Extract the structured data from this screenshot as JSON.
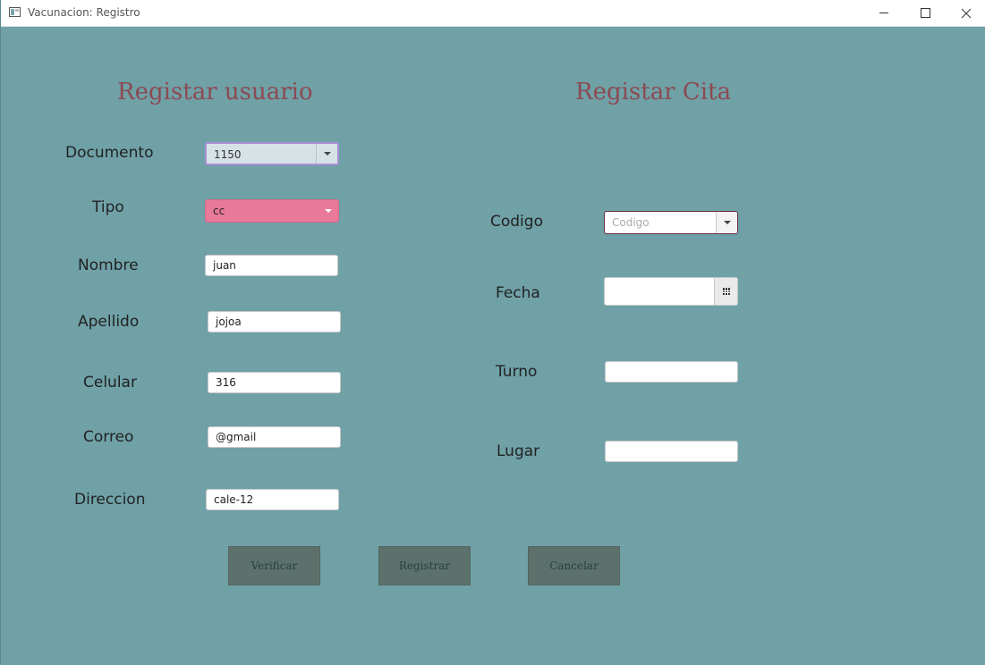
{
  "window": {
    "title": "Vacunacion: Registro",
    "controls": [
      "minimize-icon",
      "maximize-icon",
      "close-icon"
    ]
  },
  "user_form": {
    "heading": "Registar usuario",
    "documento": {
      "label": "Documento",
      "value": "1150"
    },
    "tipo": {
      "label": "Tipo",
      "value": "cc"
    },
    "nombre": {
      "label": "Nombre",
      "value": "juan"
    },
    "apellido": {
      "label": "Apellido",
      "value": "jojoa"
    },
    "celular": {
      "label": "Celular",
      "value": "316"
    },
    "correo": {
      "label": "Correo",
      "value": "@gmail"
    },
    "direccion": {
      "label": "Direccion",
      "value": "cale-12"
    }
  },
  "cita_form": {
    "heading": "Registar Cita",
    "codigo": {
      "label": "Codigo",
      "placeholder": "Codigo",
      "value": ""
    },
    "fecha": {
      "label": "Fecha",
      "value": ""
    },
    "turno": {
      "label": "Turno",
      "value": ""
    },
    "lugar": {
      "label": "Lugar",
      "value": ""
    }
  },
  "buttons": {
    "verificar": "Verificar",
    "registrar": "Registrar",
    "cancelar": "Cancelar"
  },
  "colors": {
    "background": "#6fa1a7",
    "heading": "#8c4a52",
    "tipo_combo": "#e8799a",
    "button": "#5d716c",
    "button_text": "#24423c"
  }
}
